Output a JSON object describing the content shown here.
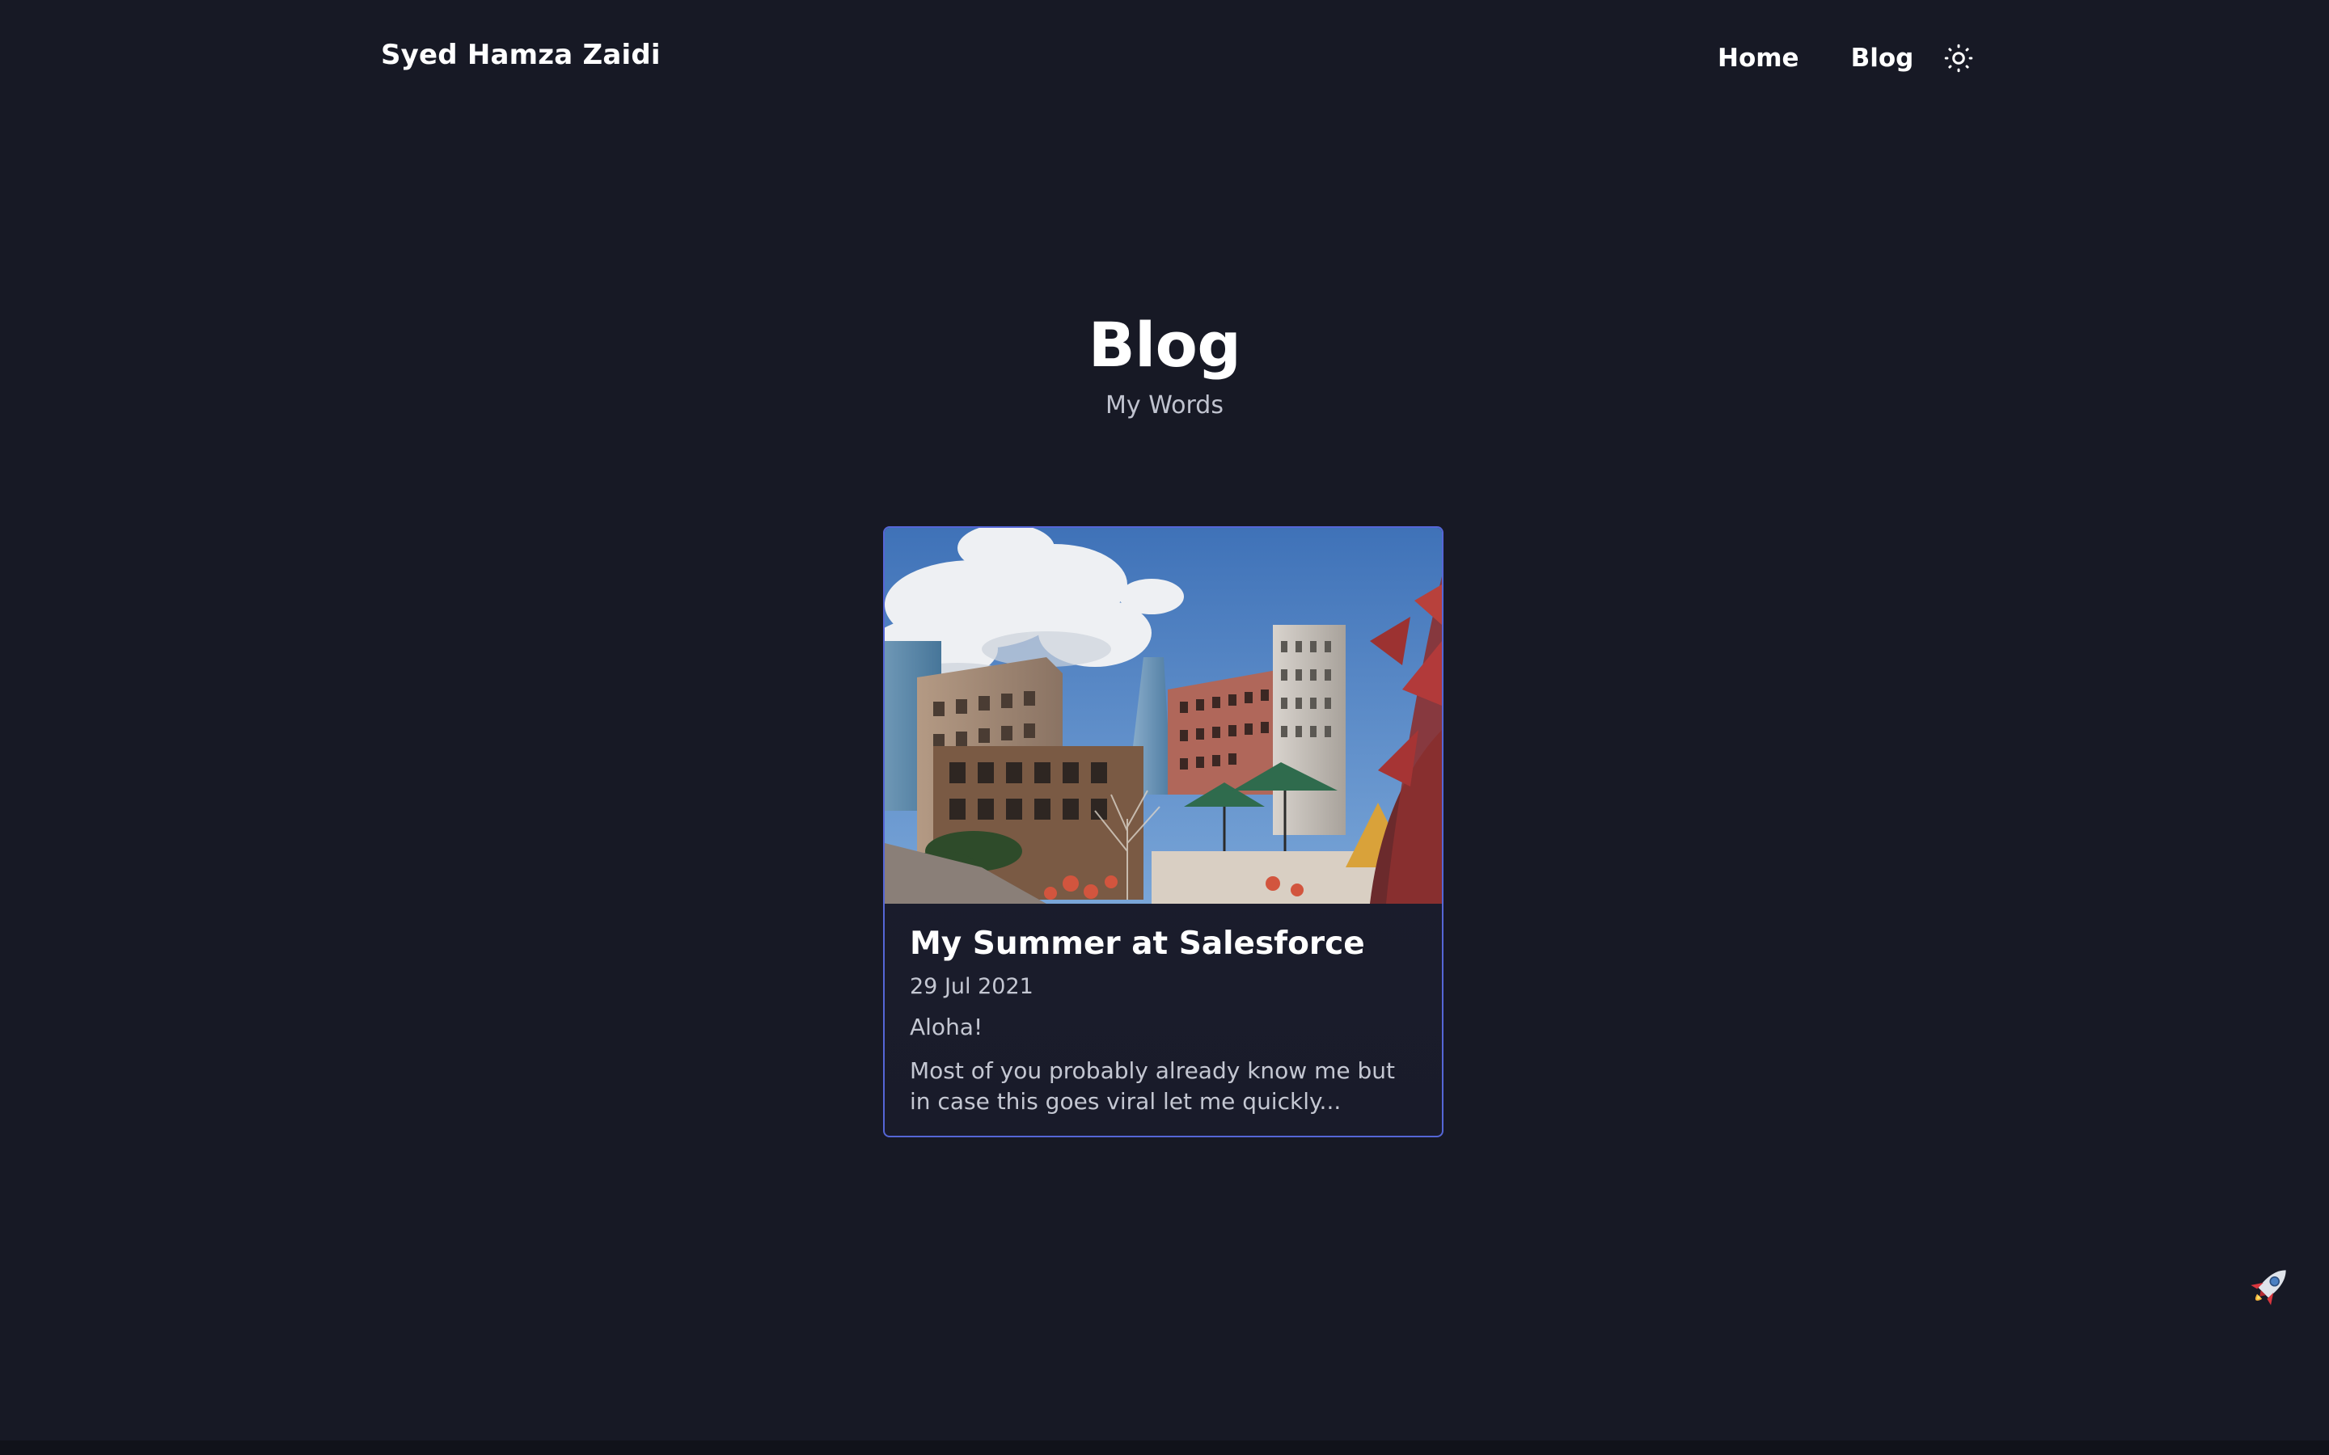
{
  "header": {
    "brand": "Syed Hamza Zaidi",
    "nav": {
      "home": "Home",
      "blog": "Blog"
    },
    "theme_toggle_icon": "sun-icon"
  },
  "hero": {
    "title": "Blog",
    "subtitle": "My Words"
  },
  "posts": [
    {
      "title": "My Summer at Salesforce",
      "date": "29 Jul 2021",
      "greeting": "Aloha!",
      "excerpt": "Most of you probably already know me but in case this goes viral let me quickly...",
      "image_icon": "city-skyline-photo"
    }
  ],
  "floating": {
    "icon": "rocket-icon"
  },
  "colors": {
    "background": "#171925",
    "accent_border": "#5566d6",
    "text_primary": "#ffffff",
    "text_secondary": "#c4c7d2"
  }
}
